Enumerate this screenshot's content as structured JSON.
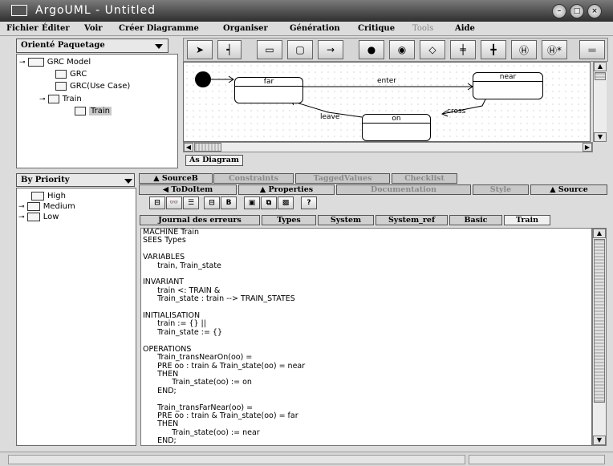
{
  "window": {
    "title": "ArgoUML - Untitled"
  },
  "menu": [
    "Fichier",
    "Éditer",
    "Voir",
    "Créer Diagramme",
    "Organiser",
    "Génération",
    "Critique",
    "Tools",
    "Aide"
  ],
  "explorer": {
    "perspective": "Orienté Paquetage",
    "tree": [
      {
        "label": "GRC Model"
      },
      {
        "label": "GRC"
      },
      {
        "label": "GRC(Use Case)"
      },
      {
        "label": "Train"
      },
      {
        "label": "Train"
      }
    ]
  },
  "todo": {
    "sort": "By Priority",
    "items": [
      "High",
      "Medium",
      "Low"
    ]
  },
  "diagram": {
    "tab": "As Diagram",
    "states": [
      "far",
      "near",
      "on"
    ],
    "transitions": [
      "enter",
      "leave",
      "cross"
    ]
  },
  "details": {
    "top_tabs": [
      "SourceB",
      "Constraints",
      "TaggedValues",
      "Checklist"
    ],
    "second_tabs": [
      "ToDoItem",
      "Properties",
      "Documentation",
      "Style",
      "Source"
    ],
    "sub_tabs": [
      "Journal des erreurs",
      "Types",
      "System",
      "System_ref",
      "Basic",
      "Train"
    ],
    "code": "MACHINE Train\nSEES Types\n\nVARIABLES\n\ttrain, Train_state\n\nINVARIANT\n\ttrain <: TRAIN &\n\tTrain_state : train --> TRAIN_STATES\n\nINITIALISATION\n\ttrain := {} ||\n\tTrain_state := {}\n\nOPERATIONS\n\tTrain_transNearOn(oo) =\n\tPRE oo : train & Train_state(oo) = near\n\tTHEN\n\t\tTrain_state(oo) := on\n\tEND;\n\n\tTrain_transFarNear(oo) =\n\tPRE oo : train & Train_state(oo) = far\n\tTHEN\n\t\tTrain_state(oo) := near\n\tEND;"
  }
}
